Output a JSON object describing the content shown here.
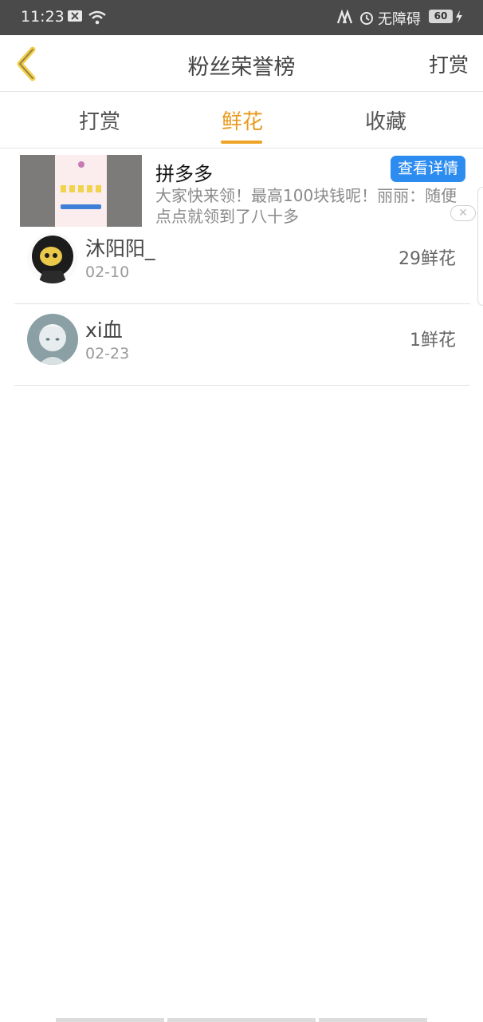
{
  "status_bar": {
    "time": "11:23",
    "accessibility": "无障碍",
    "battery": "60",
    "icons": [
      "notification-close-icon",
      "wifi-icon",
      "app-icon",
      "alarm-icon",
      "charging-icon"
    ]
  },
  "nav": {
    "title": "粉丝荣誉榜",
    "right_action": "打赏",
    "back_icon": "chevron-left-icon"
  },
  "tabs": [
    {
      "label": "打赏",
      "active": false
    },
    {
      "label": "鲜花",
      "active": true
    },
    {
      "label": "收藏",
      "active": false
    }
  ],
  "ad": {
    "title": "拼多多",
    "description": "大家快来领！最高100块钱呢！丽丽：随便点点就领到了八十多",
    "button": "查看详情",
    "close_icon": "close-icon"
  },
  "fans": [
    {
      "name": "沐阳阳_",
      "date": "02-10",
      "amount": "29鲜花"
    },
    {
      "name": "xi血",
      "date": "02-23",
      "amount": "1鲜花"
    }
  ],
  "colors": {
    "accent": "#eda323",
    "active_tab": "#e89a1e",
    "ad_button": "#2d8cf0",
    "status_bar": "#4a4a4a"
  }
}
